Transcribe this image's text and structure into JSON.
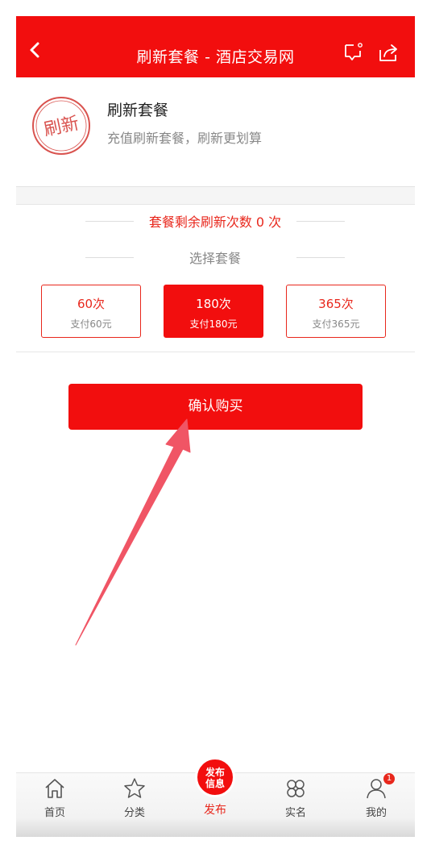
{
  "header": {
    "title": "刷新套餐 - 酒店交易网"
  },
  "package": {
    "stamp_text": "刷新",
    "title": "刷新套餐",
    "subtitle": "充值刷新套餐，刷新更划算"
  },
  "status": {
    "remaining_text": "套餐剩余刷新次数 0 次",
    "choose_label": "选择套餐"
  },
  "options": [
    {
      "count": "60次",
      "price": "支付60元",
      "selected": false
    },
    {
      "count": "180次",
      "price": "支付180元",
      "selected": true
    },
    {
      "count": "365次",
      "price": "支付365元",
      "selected": false
    }
  ],
  "confirm_label": "确认购买",
  "tabbar": {
    "home": "首页",
    "category": "分类",
    "publish_badge_line1": "发布",
    "publish_badge_line2": "信息",
    "publish": "发布",
    "realname": "实名",
    "mine": "我的",
    "mine_badge": "1"
  },
  "colors": {
    "accent": "#f20e0e",
    "text_red": "#e8271c"
  }
}
